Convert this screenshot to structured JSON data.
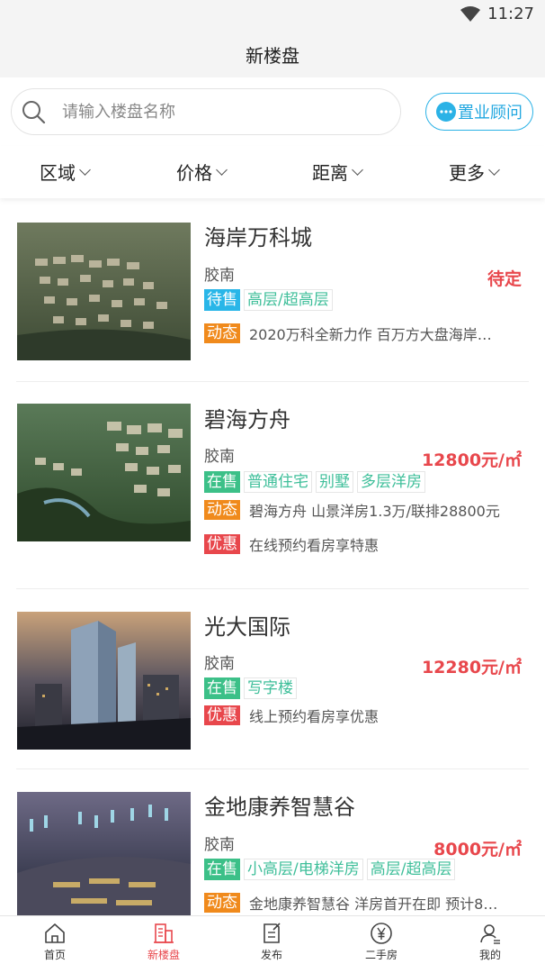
{
  "status_bar": {
    "time": "11:27"
  },
  "header": {
    "title": "新楼盘"
  },
  "search": {
    "placeholder": "请输入楼盘名称",
    "advisor_label": "置业顾问"
  },
  "filters": [
    {
      "label": "区域"
    },
    {
      "label": "价格"
    },
    {
      "label": "距离"
    },
    {
      "label": "更多"
    }
  ],
  "listings": [
    {
      "name": "海岸万科城",
      "district": "胶南",
      "price": "待定",
      "status": "待售",
      "status_color": "#29b6e8",
      "types": [
        "高层/超高层"
      ],
      "info": [
        {
          "badge": "动态",
          "color": "#f08a1c",
          "text": "2020万科全新力作 百万方大盘海岸…"
        }
      ]
    },
    {
      "name": "碧海方舟",
      "district": "胶南",
      "price": "12800元/㎡",
      "status": "在售",
      "status_color": "#3cc088",
      "types": [
        "普通住宅",
        "别墅",
        "多层洋房"
      ],
      "info": [
        {
          "badge": "动态",
          "color": "#f08a1c",
          "text": "碧海方舟 山景洋房1.3万/联排28800元"
        },
        {
          "badge": "优惠",
          "color": "#e8474c",
          "text": "在线预约看房享特惠"
        }
      ]
    },
    {
      "name": "光大国际",
      "district": "胶南",
      "price": "12280元/㎡",
      "status": "在售",
      "status_color": "#3cc088",
      "types": [
        "写字楼"
      ],
      "info": [
        {
          "badge": "优惠",
          "color": "#e8474c",
          "text": "线上预约看房享优惠"
        }
      ]
    },
    {
      "name": "金地康养智慧谷",
      "district": "胶南",
      "price": "8000元/㎡",
      "status": "在售",
      "status_color": "#3cc088",
      "types": [
        "小高层/电梯洋房",
        "高层/超高层"
      ],
      "info": [
        {
          "badge": "动态",
          "color": "#f08a1c",
          "text": "金地康养智慧谷 洋房首开在即 预计8…"
        }
      ]
    }
  ],
  "tabbar": [
    {
      "label": "首页",
      "icon": "home-icon",
      "active": false
    },
    {
      "label": "新楼盘",
      "icon": "building-icon",
      "active": true
    },
    {
      "label": "发布",
      "icon": "post-icon",
      "active": false
    },
    {
      "label": "二手房",
      "icon": "yen-icon",
      "active": false
    },
    {
      "label": "我的",
      "icon": "user-icon",
      "active": false
    }
  ],
  "colors": {
    "accent_red": "#e8474c",
    "accent_blue": "#2bb2e6",
    "tag_green": "#3fbf9a"
  }
}
